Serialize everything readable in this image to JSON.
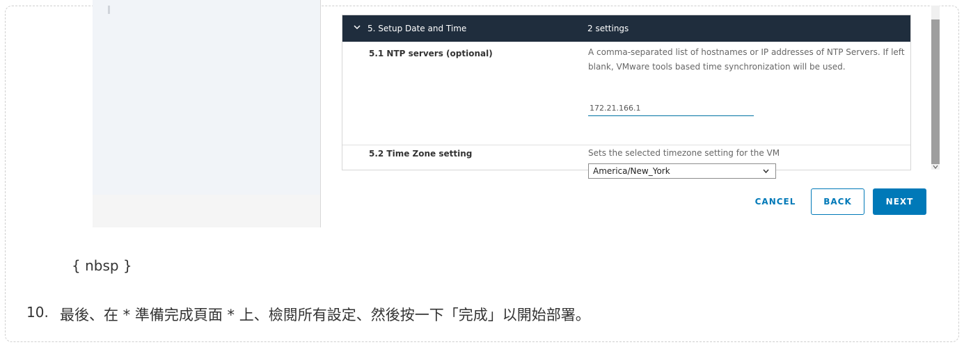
{
  "section": {
    "title": "5. Setup Date and Time",
    "count": "2 settings",
    "rows": [
      {
        "label": "5.1 NTP servers (optional)",
        "description": "A comma-separated list of hostnames or IP addresses of NTP Servers. If left blank, VMware tools based time synchronization will be used.",
        "value": "172.21.166.1"
      },
      {
        "label": "5.2 Time Zone setting",
        "description": "Sets the selected timezone setting for the VM",
        "value": "America/New_York"
      }
    ]
  },
  "buttons": {
    "cancel": "CANCEL",
    "back": "BACK",
    "next": "NEXT"
  },
  "doc": {
    "nbsp": "{ nbsp }",
    "step_number": "10.",
    "step_text": "最後、在 * 準備完成頁面 * 上、檢閱所有設定、然後按一下「完成」以開始部署。"
  },
  "colors": {
    "header_bg": "#1f2d3d",
    "accent": "#0079b8"
  }
}
